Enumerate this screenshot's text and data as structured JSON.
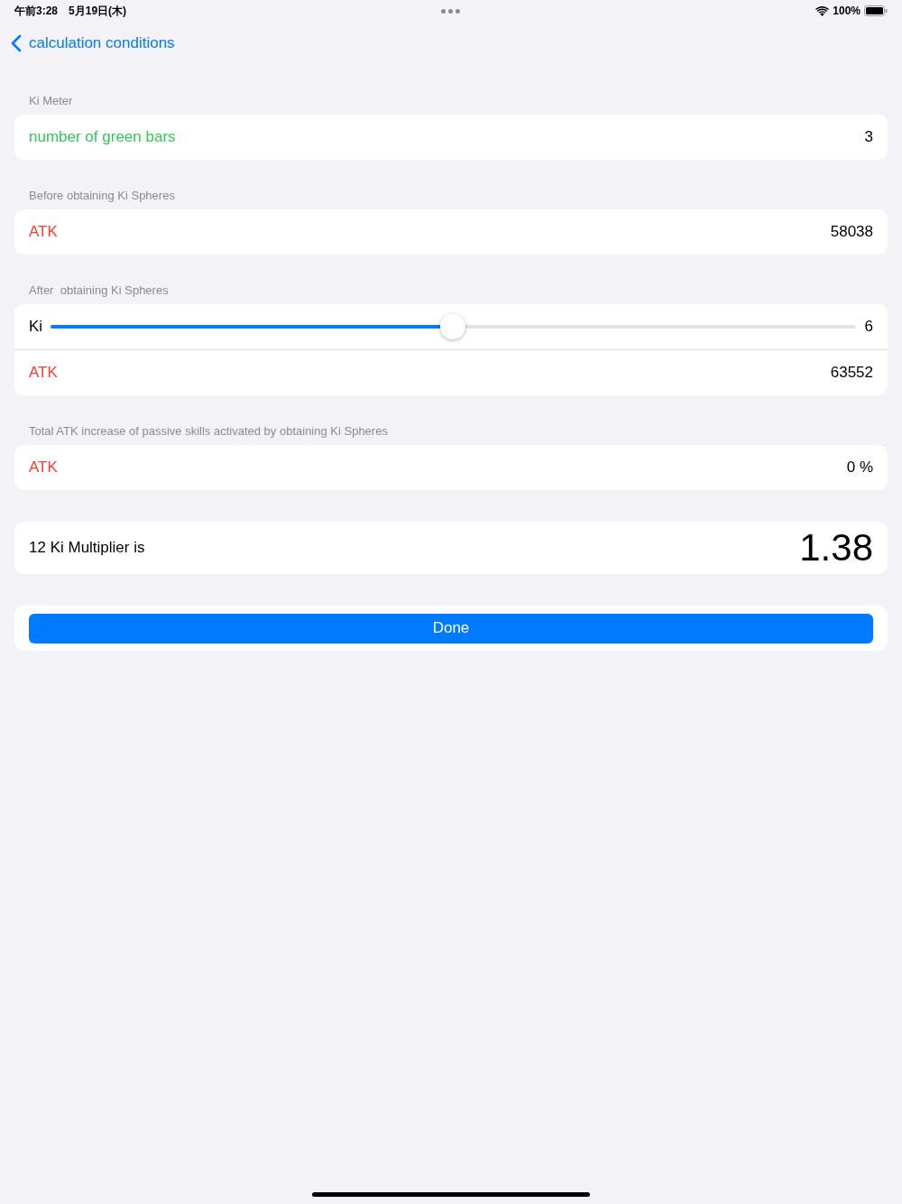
{
  "status_bar": {
    "time": "午前3:28",
    "date": "5月19日(木)",
    "battery": "100%"
  },
  "nav": {
    "back_label": "calculation conditions"
  },
  "sections": [
    {
      "header": "Ki Meter",
      "rows": [
        {
          "kind": "value",
          "label": "number of green bars",
          "color": "#34c759",
          "value": "3"
        }
      ]
    },
    {
      "header": "Before obtaining Ki Spheres",
      "rows": [
        {
          "kind": "value",
          "label": "ATK",
          "color": "#ff3b30",
          "value": "58038"
        }
      ]
    },
    {
      "header": "After  obtaining Ki Spheres",
      "rows": [
        {
          "kind": "slider",
          "label": "Ki",
          "level": 0.5,
          "reading": "6"
        },
        {
          "kind": "value",
          "label": "ATK",
          "color": "#ff3b30",
          "value": "63552"
        }
      ]
    },
    {
      "header": "Total ATK increase of passive skills activated by obtaining Ki Spheres",
      "rows": [
        {
          "kind": "value",
          "label": "ATK",
          "color": "#ff3b30",
          "value": "0 %"
        }
      ]
    },
    {
      "rows": [
        {
          "kind": "result",
          "label": "12 Ki Multiplier is",
          "value": "1.38"
        }
      ]
    },
    {
      "rows": [
        {
          "kind": "button",
          "label": "Done"
        }
      ]
    }
  ]
}
